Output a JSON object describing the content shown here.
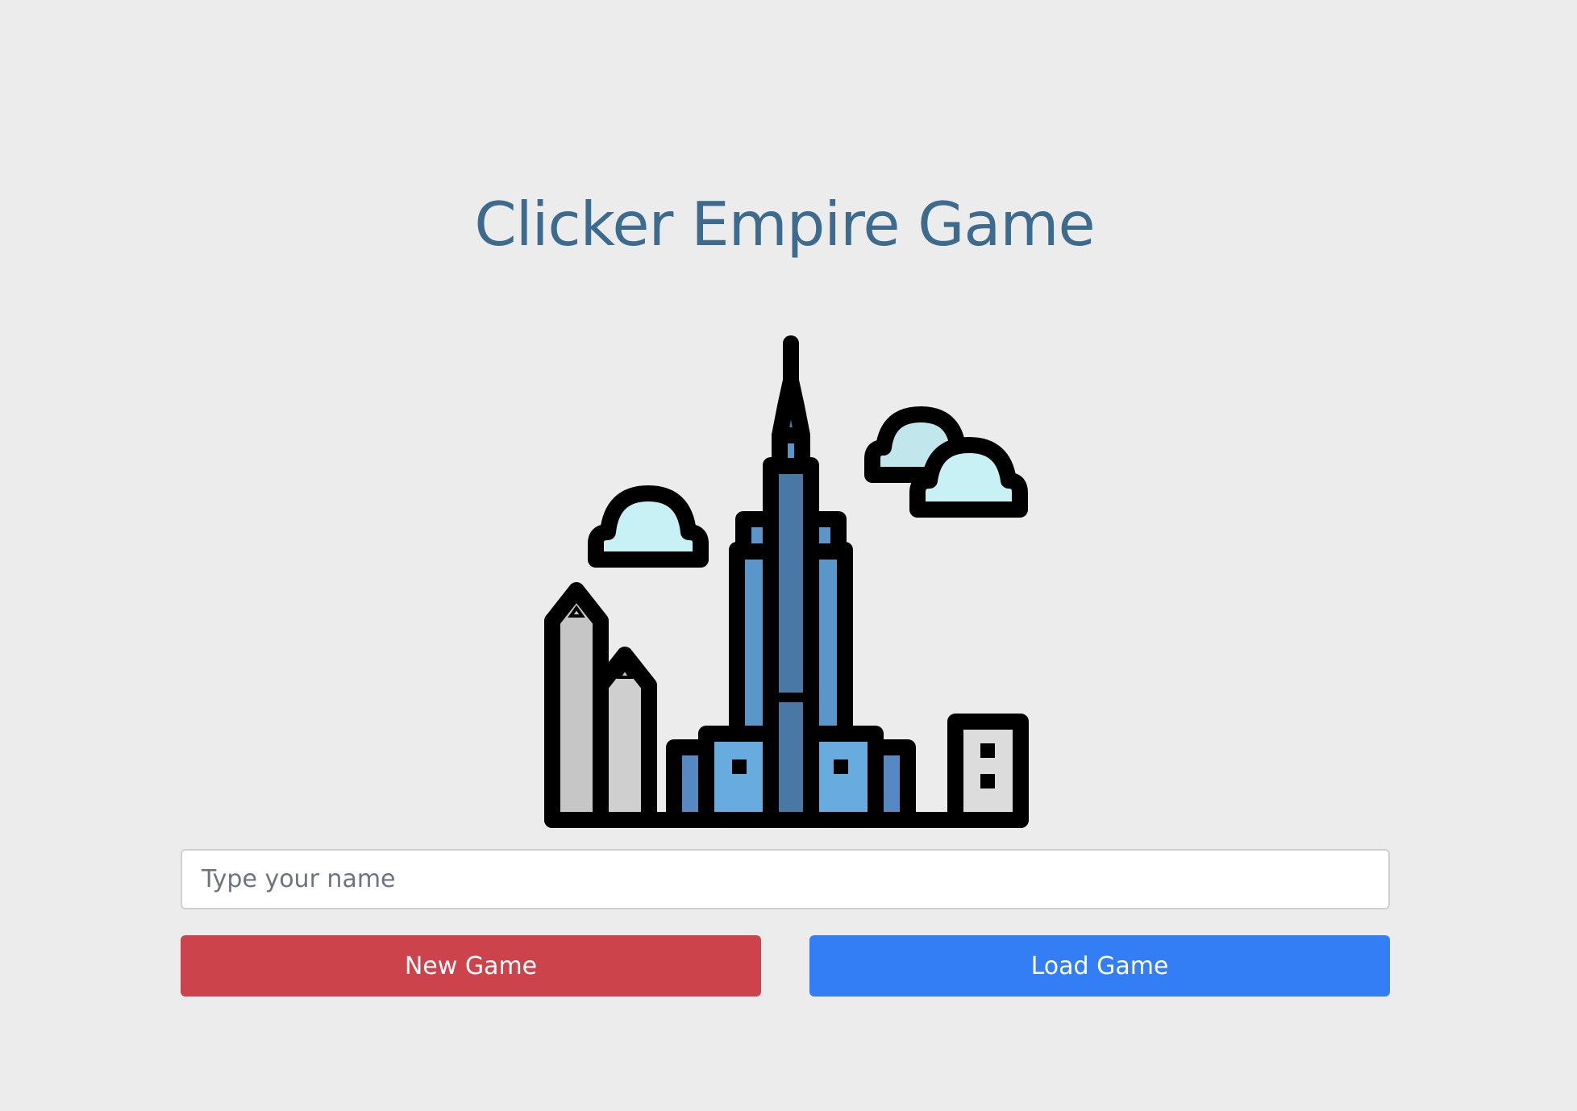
{
  "page": {
    "title": "Clicker Empire Game",
    "logo_icon": "city-skyline-icon",
    "title_color": "#3d6b8e",
    "background_color": "#ececec"
  },
  "form": {
    "name_input": {
      "placeholder": "Type your name",
      "value": ""
    },
    "new_game_button": {
      "label": "New Game",
      "color": "#cc434b"
    },
    "load_game_button": {
      "label": "Load Game",
      "color": "#337ef4"
    }
  }
}
